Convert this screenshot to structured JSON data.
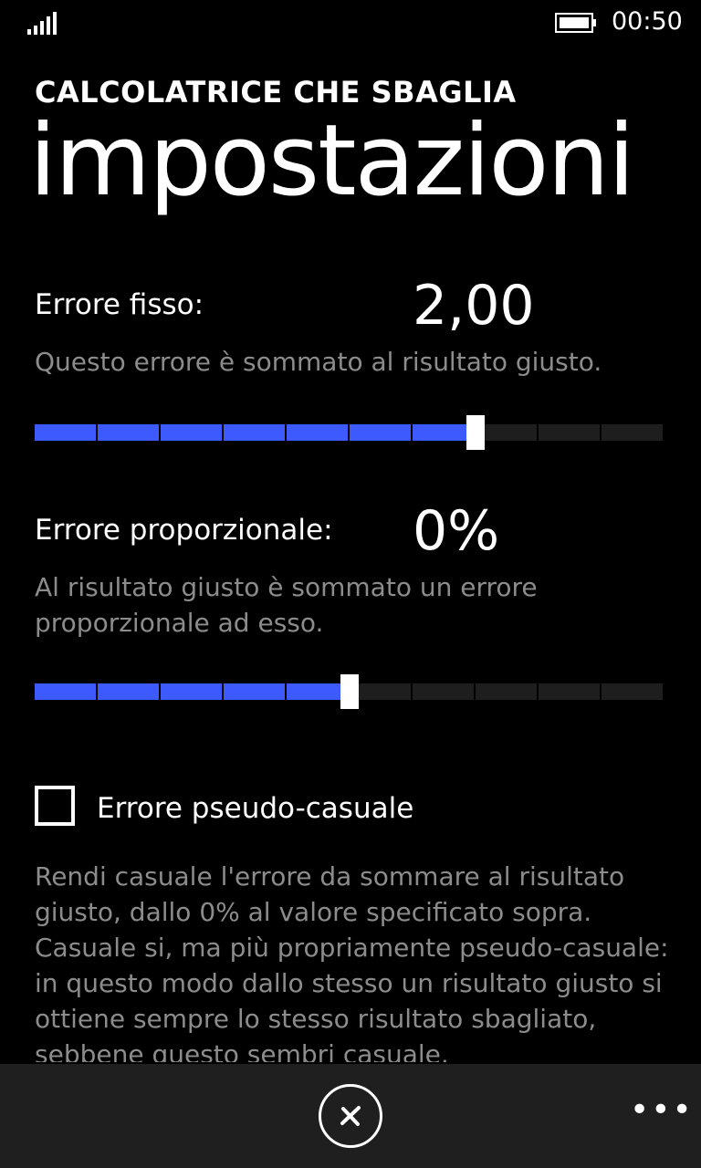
{
  "status": {
    "time": "00:50",
    "signal_icon": "signal-bars-icon",
    "battery_icon": "battery-icon"
  },
  "app_title": "CALCOLATRICE CHE SBAGLIA",
  "page_title": "impostazioni",
  "fixed_error": {
    "label": "Errore fisso:",
    "value": "2,00",
    "description": "Questo errore è sommato al risultato giusto.",
    "slider_fraction": 0.7
  },
  "proportional_error": {
    "label": "Errore proporzionale:",
    "value": "0%",
    "description": "Al risultato giusto è sommato un errore proporzionale ad esso.",
    "slider_fraction": 0.5
  },
  "pseudo_random": {
    "label": "Errore pseudo-casuale",
    "checked": false,
    "description": "Rendi casuale l'errore da sommare al risultato giusto, dallo 0% al valore specificato sopra. Casuale si, ma più propriamente pseudo-casuale: in questo modo dallo stesso un risultato giusto si ottiene sempre lo stesso risultato sbagliato, sebbene questo sembri casuale."
  },
  "app_bar": {
    "cancel_icon": "close-circle-icon",
    "more_icon": "more-icon"
  },
  "colors": {
    "accent": "#3d5afe",
    "track": "#1e1e1e",
    "appbar": "#1f1f1f",
    "secondary_text": "#8c8c8c"
  }
}
